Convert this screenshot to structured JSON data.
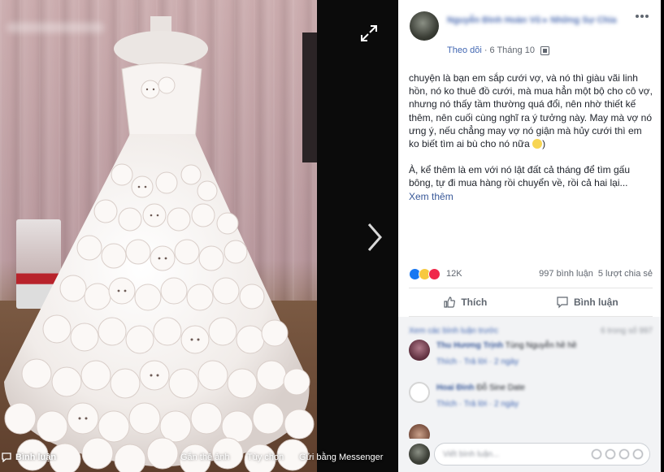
{
  "viewer": {
    "blurred_caption": "",
    "bottom": {
      "comment_label": "Bình luận",
      "tag_label": "Gắn thẻ ảnh",
      "options_label": "Tùy chọn",
      "messenger_label": "Gửi bằng Messenger"
    },
    "icons": [
      "expand-icon",
      "next-arrow-icon",
      "comment-icon"
    ]
  },
  "post": {
    "author": "Nguyễn Đình Hoàn Vũ ▸ Những Sự Chia",
    "follow_label": "Theo dõi",
    "separator": "·",
    "date": "6 Tháng 10",
    "paragraph_1": "chuyện là bạn em sắp cưới vợ, và nó thì giàu vãi linh hồn, nó ko thuê đồ cưới, mà mua hẳn một bộ cho cô vợ, nhưng nó thấy tầm thường quá đổi, nên nhờ thiết kế thêm, nên cuối cùng nghĩ ra ý tưởng này. May mà vợ nó ưng ý, nếu chẳng may vợ nó giận mà hủy cưới thì em ko biết tìm ai bù cho nó nữa",
    "paragraph_1_end": ")",
    "paragraph_2": "À, kể thêm là em với nó lật đất cả tháng để tìm gấu bông, tự đi mua hàng rồi chuyển về, rồi cả hai lại...",
    "see_more": "Xem thêm",
    "reactions": {
      "count": "12K",
      "comments": "997 bình luận",
      "shares": "5 lượt chia sẻ"
    },
    "actions": {
      "like": "Thích",
      "comment": "Bình luận"
    }
  },
  "comments": {
    "previous_label": "Xem các bình luận trước",
    "previous_count": "6 trong số 997",
    "items": [
      {
        "name": "Thu Hương Trịnh",
        "text": "Tùng Nguyễn hề hề",
        "like": "Thích",
        "reply": "Trả lời",
        "time": "2 ngày"
      },
      {
        "name": "Hoai Đinh",
        "text": "Đỗ Sine Date",
        "like": "Thích",
        "reply": "Trả lời",
        "time": "2 ngày"
      },
      {
        "name": "",
        "text": "",
        "like": "",
        "reply": "",
        "time": ""
      }
    ],
    "write_placeholder": "Viết bình luận..."
  },
  "colors": {
    "facebook_blue": "#4267b2",
    "link_blue": "#385898",
    "text": "#1d2129",
    "muted": "#616770",
    "like": "#1877f2",
    "haha": "#f7c941",
    "love": "#f0284a"
  }
}
